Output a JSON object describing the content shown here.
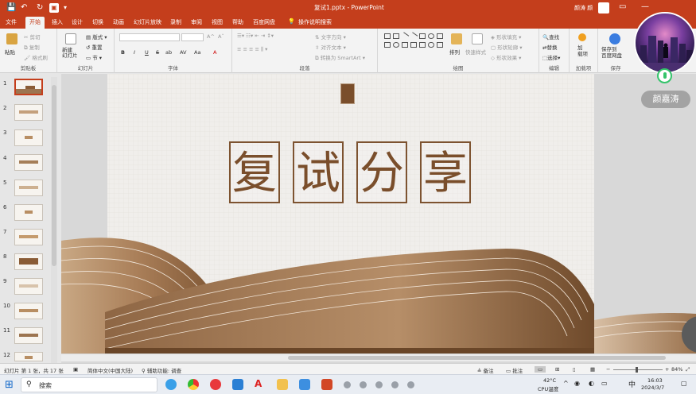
{
  "titlebar": {
    "file_title": "复试1.pptx  -  PowerPoint",
    "user_name": "颜涛 颜",
    "save_icon": "save-icon",
    "undo_icon": "undo-icon",
    "redo_icon": "redo-icon"
  },
  "tabs": [
    "文件",
    "开始",
    "插入",
    "设计",
    "切换",
    "动画",
    "幻灯片放映",
    "录制",
    "审阅",
    "视图",
    "帮助",
    "百度网盘",
    "操作说明搜索"
  ],
  "active_tab": "开始",
  "ribbon": {
    "clipboard": {
      "label": "剪贴板",
      "paste": "粘贴",
      "cut": "剪切",
      "copy": "复制",
      "format_painter": "格式刷"
    },
    "slides": {
      "label": "幻灯片",
      "new_slide": "新建\n幻灯片",
      "layout": "版式",
      "reset": "重置",
      "section": "节"
    },
    "font": {
      "label": "字体",
      "bold": "B",
      "italic": "I",
      "underline": "U",
      "strike": "S",
      "shadow": "ab",
      "spacing": "AV",
      "case": "Aa",
      "color": "A"
    },
    "paragraph": {
      "label": "段落",
      "text_direction": "文字方向",
      "align_text": "对齐文本",
      "smartart": "转换为 SmartArt"
    },
    "drawing": {
      "label": "绘图",
      "arrange": "排列",
      "quick_styles": "快速样式",
      "fill": "形状填充",
      "outline": "形状轮廓",
      "effects": "形状效果"
    },
    "editing": {
      "label": "编辑",
      "find": "查找",
      "replace": "替换",
      "select": "选择"
    },
    "addins": {
      "label": "加载项",
      "addins": "加\n载项"
    },
    "save": {
      "label": "保存",
      "save_baidu": "保存到\n百度网盘"
    }
  },
  "thumbnails": [
    "1",
    "2",
    "3",
    "4",
    "5",
    "6",
    "7",
    "8",
    "9",
    "10",
    "11",
    "12"
  ],
  "selected_slide": "1",
  "slide": {
    "chars": [
      "复",
      "试",
      "分",
      "享"
    ]
  },
  "statusbar": {
    "slide_info": "幻灯片 第 1 张，共 17 张",
    "language": "简体中文(中国大陆)",
    "accessibility": "辅助功能: 调查",
    "notes": "备注",
    "comments": "批注",
    "zoom": "84%"
  },
  "taskbar": {
    "search_placeholder": "搜索",
    "temperature": "42°C",
    "cpu": "CPU温度",
    "ime": "中",
    "time": "16:03",
    "date": "2024/3/7"
  },
  "meeting": {
    "participant_name": "颜嘉涛"
  },
  "colors": {
    "brand": "#c43e1c",
    "title_brown": "#7a4e2b",
    "wave_dark": "#8b6440",
    "wave_light": "#c8a582"
  }
}
